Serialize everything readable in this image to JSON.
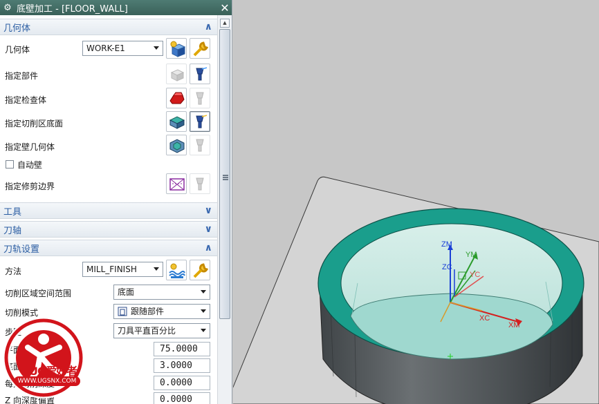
{
  "dialog": {
    "title": "底壁加工 - [FLOOR_WALL]",
    "geometry_section": {
      "header": "几何体",
      "geometry_label": "几何体",
      "geometry_value": "WORK-E1",
      "specify_part": "指定部件",
      "specify_check": "指定检查体",
      "specify_cut_floor": "指定切削区底面",
      "specify_wall": "指定壁几何体",
      "auto_wall": "自动壁",
      "specify_trim": "指定修剪边界"
    },
    "tool_section": {
      "header": "工具"
    },
    "axis_section": {
      "header": "刀轴"
    },
    "path_section": {
      "header": "刀轨设置",
      "method_label": "方法",
      "method_value": "MILL_FINISH",
      "cut_region_label": "切削区域空间范围",
      "cut_region_value": "底面",
      "cut_pattern_label": "切削模式",
      "cut_pattern_value": "跟随部件",
      "stepover_label": "步距",
      "stepover_value": "刀具平直百分比",
      "flat_dia_label": "平面直径百分比",
      "flat_dia_value": "75.0000",
      "floor_stock_label": "底面毛坯厚度",
      "floor_stock_value": "3.0000",
      "depth_per_cut_label": "每刀切削深度",
      "depth_per_cut_value": "0.0000",
      "z_offset_label": "Z 向深度偏置",
      "z_offset_value": "0.0000"
    }
  },
  "viewport": {
    "axes": {
      "zm": "ZM",
      "ym": "YM",
      "zc": "ZC",
      "yc": "YC",
      "xc": "XC",
      "xm": "XM"
    },
    "colors": {
      "ring": "#1a9e8c",
      "floor": "#9fd8cf",
      "body": "#555a5d"
    }
  },
  "watermark": {
    "text": "UG爱好者",
    "url": "WWW.UGSNX.COM"
  }
}
